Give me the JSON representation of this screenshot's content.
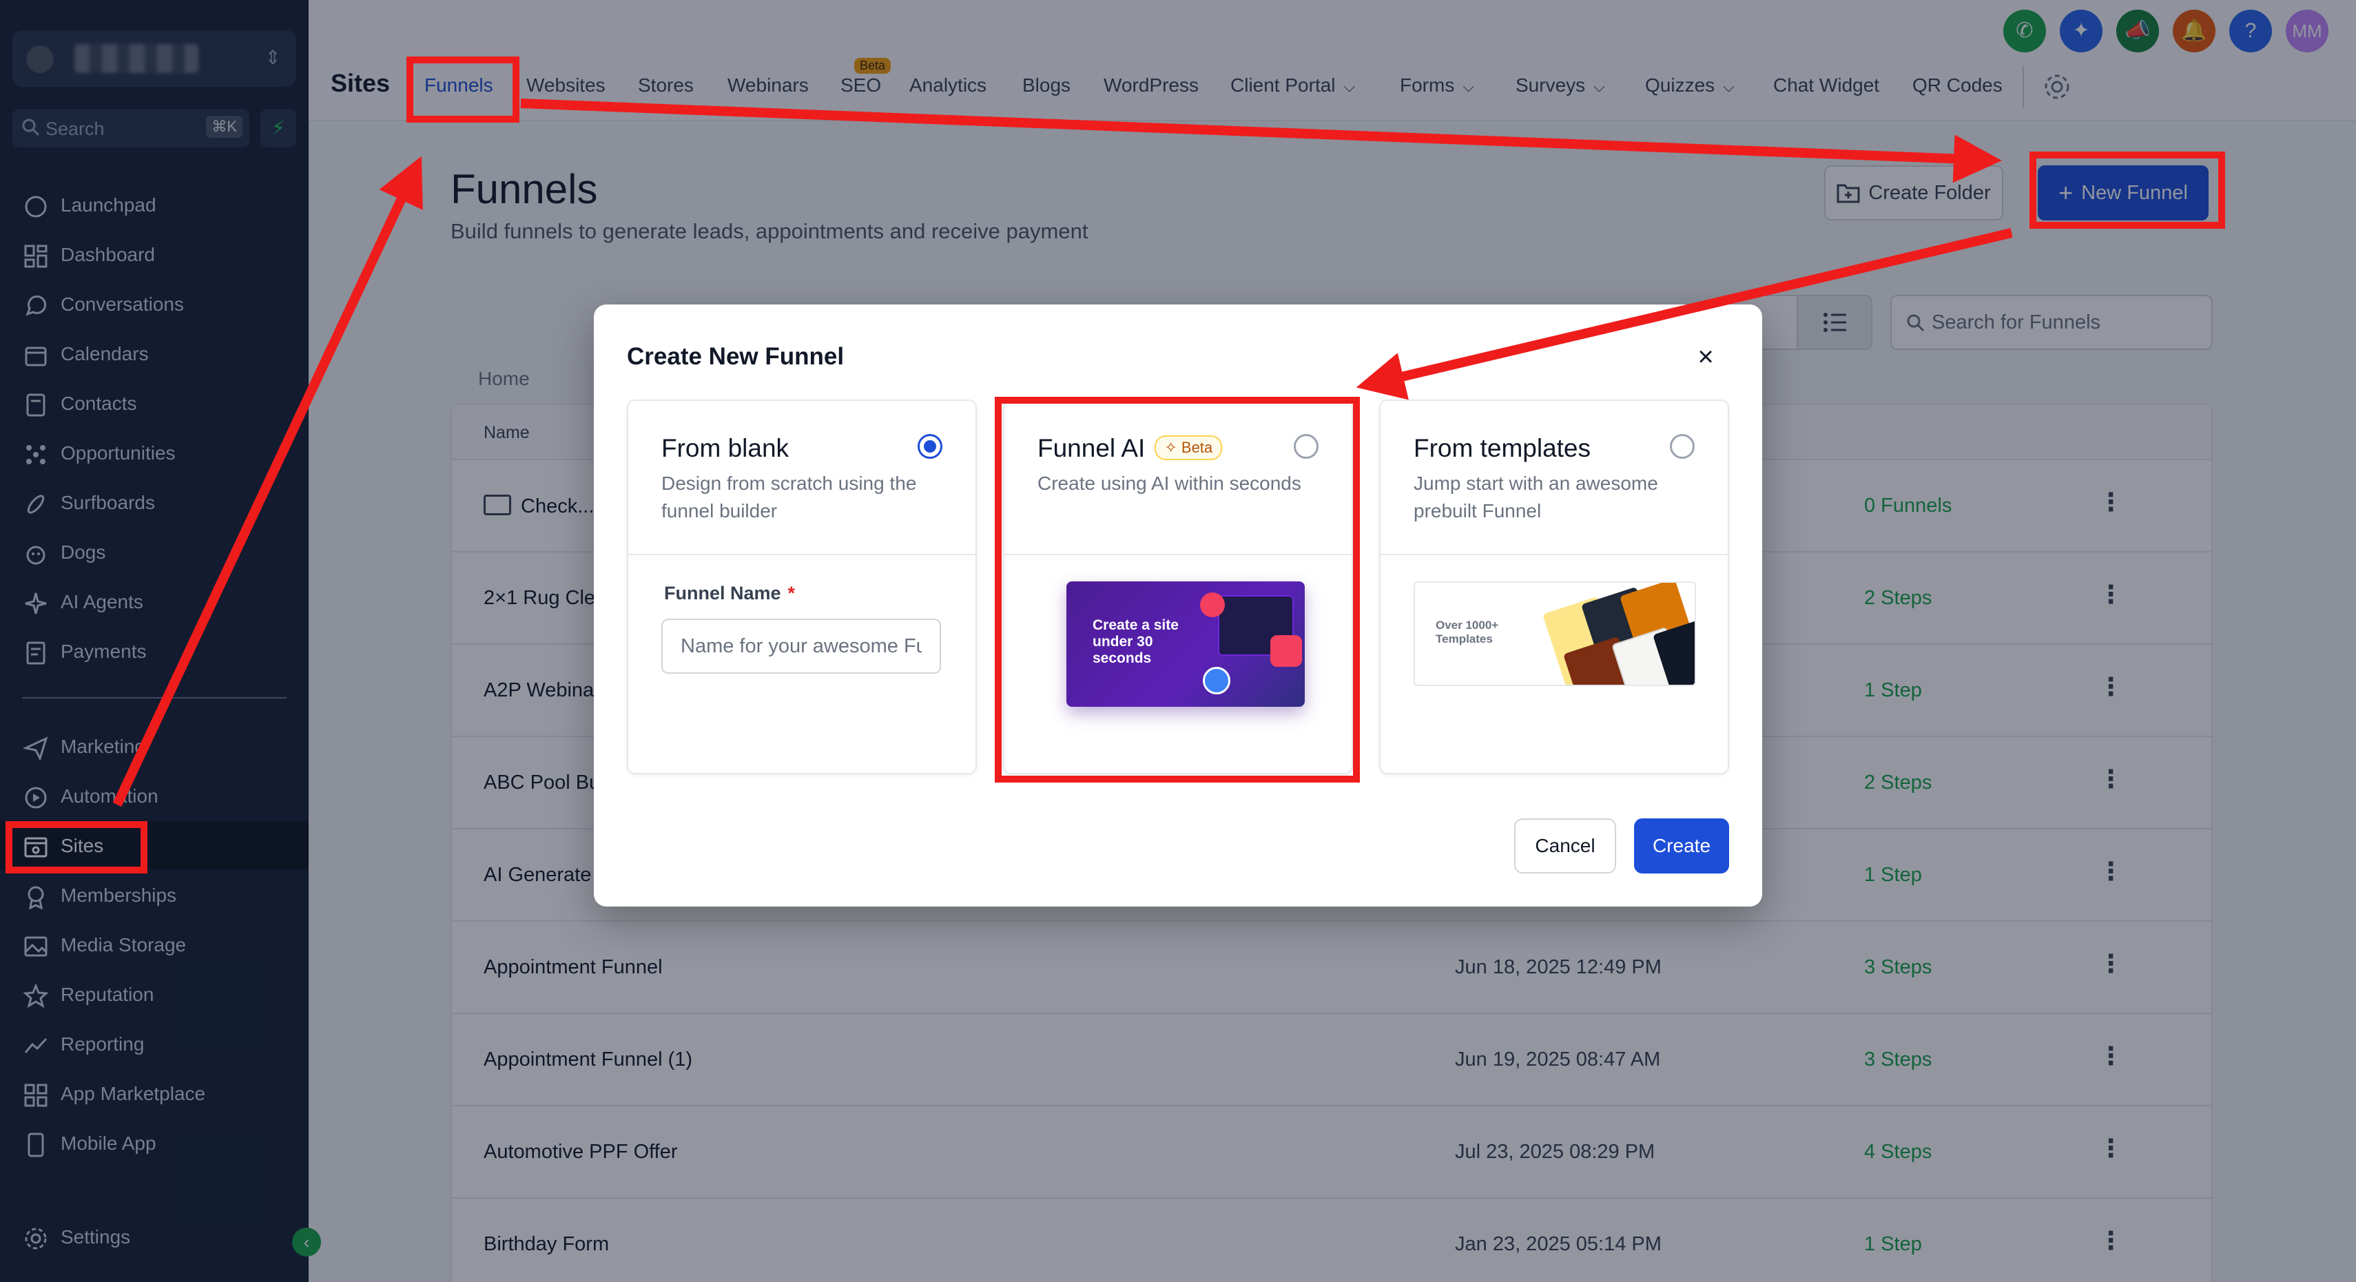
{
  "sidebar": {
    "search_label": "Search",
    "search_shortcut": "⌘K",
    "items": [
      {
        "label": "Launchpad",
        "icon": "rocket-icon"
      },
      {
        "label": "Dashboard",
        "icon": "dashboard-icon"
      },
      {
        "label": "Conversations",
        "icon": "chat-icon"
      },
      {
        "label": "Calendars",
        "icon": "calendar-icon"
      },
      {
        "label": "Contacts",
        "icon": "contacts-icon"
      },
      {
        "label": "Opportunities",
        "icon": "opportunities-icon"
      },
      {
        "label": "Surfboards",
        "icon": "surfboard-icon"
      },
      {
        "label": "Dogs",
        "icon": "dog-icon"
      },
      {
        "label": "AI Agents",
        "icon": "ai-sparkle-icon"
      },
      {
        "label": "Payments",
        "icon": "payments-icon"
      }
    ],
    "items2": [
      {
        "label": "Marketing",
        "icon": "send-icon"
      },
      {
        "label": "Automation",
        "icon": "automation-icon"
      },
      {
        "label": "Sites",
        "icon": "sites-icon"
      },
      {
        "label": "Memberships",
        "icon": "membership-icon"
      },
      {
        "label": "Media Storage",
        "icon": "image-icon"
      },
      {
        "label": "Reputation",
        "icon": "star-icon"
      },
      {
        "label": "Reporting",
        "icon": "chart-icon"
      },
      {
        "label": "App Marketplace",
        "icon": "grid-icon"
      },
      {
        "label": "Mobile App",
        "icon": "mobile-icon"
      },
      {
        "label": "Settings",
        "icon": "gear-icon"
      }
    ]
  },
  "topbar": {
    "title": "Sites",
    "tabs": [
      {
        "label": "Funnels"
      },
      {
        "label": "Websites"
      },
      {
        "label": "Stores"
      },
      {
        "label": "Webinars"
      },
      {
        "label": "SEO",
        "badge": "Beta"
      },
      {
        "label": "Analytics"
      },
      {
        "label": "Blogs"
      },
      {
        "label": "WordPress"
      },
      {
        "label": "Client Portal"
      },
      {
        "label": "Forms"
      },
      {
        "label": "Surveys"
      },
      {
        "label": "Quizzes"
      },
      {
        "label": "Chat Widget"
      },
      {
        "label": "QR Codes"
      }
    ],
    "user_initials": "MM"
  },
  "page": {
    "title": "Funnels",
    "subtitle": "Build funnels to generate leads, appointments and receive payment",
    "create_folder": "Create Folder",
    "new_funnel": "New Funnel",
    "search_placeholder": "Search for Funnels",
    "breadcrumb": "Home",
    "col_name": "Name"
  },
  "rows": [
    {
      "name": "Check...",
      "date": "",
      "steps": "0 Funnels"
    },
    {
      "name": "2×1 Rug Cle",
      "date": "",
      "steps": "2 Steps"
    },
    {
      "name": "A2P Webina",
      "date": "",
      "steps": "1 Step"
    },
    {
      "name": "ABC Pool Bu",
      "date": "",
      "steps": "2 Steps"
    },
    {
      "name": "AI Generate",
      "date": "",
      "steps": "1 Step"
    },
    {
      "name": "Appointment Funnel",
      "date": "Jun 18, 2025 12:49 PM",
      "steps": "3 Steps"
    },
    {
      "name": "Appointment Funnel (1)",
      "date": "Jun 19, 2025 08:47 AM",
      "steps": "3 Steps"
    },
    {
      "name": "Automotive PPF Offer",
      "date": "Jul 23, 2025 08:29 PM",
      "steps": "4 Steps"
    },
    {
      "name": "Birthday Form",
      "date": "Jan 23, 2025 05:14 PM",
      "steps": "1 Step"
    }
  ],
  "modal": {
    "title": "Create New Funnel",
    "close": "×",
    "blank_title": "From blank",
    "blank_desc": "Design from scratch using the funnel builder",
    "funnel_name_label": "Funnel Name",
    "required_mark": "*",
    "funnel_name_placeholder": "Name for your awesome Funnel",
    "ai_title": "Funnel AI",
    "ai_badge": "Beta",
    "ai_desc": "Create using AI within seconds",
    "ai_thumb_text": "Create a site under 30 seconds",
    "templates_title": "From templates",
    "templates_desc": "Jump start with an awesome prebuilt Funnel",
    "templates_thumb_text": "Over 1000+ Templates",
    "cancel": "Cancel",
    "create": "Create"
  },
  "colors": {
    "sidebar_bg": "#152033",
    "primary": "#1d4ed8",
    "annotation": "#ef1c1c",
    "success": "#16a34a"
  }
}
